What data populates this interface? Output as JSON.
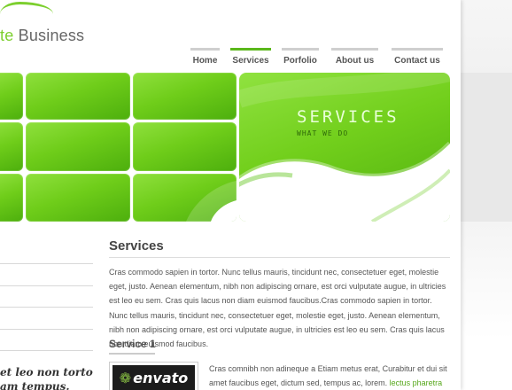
{
  "logo": {
    "accent": "te",
    "rest": " Business"
  },
  "nav": {
    "items": [
      {
        "label": "Home"
      },
      {
        "label": "Services"
      },
      {
        "label": "Porfolio"
      },
      {
        "label": "About us"
      },
      {
        "label": "Contact us"
      }
    ],
    "active": "Services"
  },
  "banner": {
    "title": "SERVICES",
    "subtitle": "WHAT WE DO"
  },
  "main": {
    "title": "Services",
    "intro": "Cras commodo sapien in tortor. Nunc tellus mauris, tincidunt nec, consectetuer eget, molestie eget, justo. Aenean elementum, nibh non adipiscing ornare, est orci vulputate augue, in ultricies est leo eu sem. Cras quis lacus non diam euismod faucibus.Cras commodo sapien in tortor. Nunc tellus mauris, tincidunt nec, consectetuer eget, molestie eget, justo. Aenean elementum, nibh non adipiscing ornare, est orci vulputate augue, in ultricies est leo eu sem. Cras quis lacus non diam euismod faucibus.",
    "service1": {
      "title": "Service 1",
      "thumb_label": "envato",
      "text": "Cras comnibh non adineque a Etiam metus erat, Curabitur et dui sit amet faucibus eget, dictum sed, tempus ac, lorem.",
      "link": "lectus pharetra volutpat."
    }
  },
  "sidebar": {
    "quote_line1": "et leo non tortor",
    "quote_line2": "am tempus."
  },
  "colors": {
    "accent": "#7ccf2e",
    "nav_active": "#5bb81b",
    "banner_green": "#6fcd1a",
    "link": "#56a81b"
  }
}
